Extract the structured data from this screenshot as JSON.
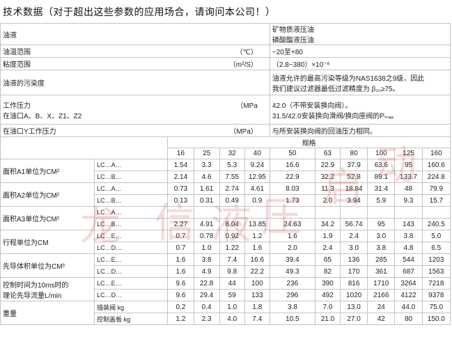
{
  "title": "技术数据（对于超出这些参数的应用场合，请询问本公司！）",
  "watermark": "龙 信 液 压 启 动",
  "info_rows": [
    {
      "label": "油液",
      "unit": "",
      "value": "矿物质液压油",
      "value2": "磷酸酯液压油"
    },
    {
      "label": "油温范围",
      "unit": "（℃）",
      "value": "−20至+80"
    },
    {
      "label": "粘度范围",
      "unit": "（m²/S）",
      "value": "（2.8−380）×10⁻⁶"
    },
    {
      "label": "油液的污染度",
      "unit": "",
      "value": "油液允许的最高污染等级为NAS1638之9级，因此",
      "value2": "我们建议过滤器最低过滤精度为 β₁₀≥75。"
    },
    {
      "label": "工作压力",
      "label2": "在油口A、B、X、Z1、Z2",
      "unit": "（MPa",
      "value": "42.0（不带安装换向阀）。",
      "value2": "31.5/42.0安装换向滑阀/换向座阀的Pₘₐₓ"
    },
    {
      "label": "在油口Y工作压力",
      "unit": "（MPa）",
      "value": "与所安装换向阀的回油压力相同。"
    }
  ],
  "spec_header": "规格",
  "sizes": [
    "16",
    "25",
    "32",
    "40",
    "50",
    "63",
    "80",
    "100",
    "125",
    "160"
  ],
  "spec_groups": [
    {
      "label": "面积A1单位为CM²",
      "rows": [
        {
          "sub": "LC…A…",
          "vals": [
            "1.54",
            "3.3",
            "5.3",
            "9.24",
            "16.6",
            "22.9",
            "37.9",
            "63.6",
            "95",
            "160.6"
          ]
        },
        {
          "sub": "LC…B…",
          "vals": [
            "2.14",
            "4.6",
            "7.55",
            "12.95",
            "22.9",
            "32.2",
            "52.8",
            "89.1",
            "133.7",
            "224.8"
          ]
        }
      ]
    },
    {
      "label": "面积A2单位为CM²",
      "rows": [
        {
          "sub": "LC…A…",
          "vals": [
            "0.73",
            "1.61",
            "2.74",
            "4.61",
            "8.03",
            "11.3",
            "18.84",
            "31.4",
            "48",
            "79.9"
          ]
        },
        {
          "sub": "LC…B…",
          "vals": [
            "0.13",
            "0.31",
            "0.49",
            "0.9",
            "1.73",
            "2.0",
            "3.94",
            "5.9",
            "9.3",
            "15.7"
          ]
        }
      ]
    },
    {
      "label": "面积A3单位为CM²",
      "rows": [
        {
          "sub": "LC…A…",
          "vals": [
            "",
            "",
            "",
            "",
            "",
            "",
            "",
            "",
            "",
            ""
          ]
        },
        {
          "sub": "LC…B…",
          "vals": [
            "2.27",
            "4.91",
            "8.04",
            "13.85",
            "24.63",
            "34.2",
            "56.74",
            "95",
            "143",
            "240.5"
          ]
        }
      ]
    },
    {
      "label": "行程单位为CM",
      "rows": [
        {
          "sub": "LC…E…",
          "vals": [
            "0.7",
            "0.78",
            "0.92",
            "1.2",
            "1.6",
            "1.9",
            "2.4",
            "3.0",
            "3.8",
            "5.0"
          ]
        },
        {
          "sub": "LC…D…",
          "vals": [
            "0.7",
            "1.0",
            "1.22",
            "1.6",
            "2.0",
            "2.4",
            "3.0",
            "3.8",
            "4.8",
            "6.5"
          ]
        }
      ]
    },
    {
      "label": "先导体积单位为CM³",
      "rows": [
        {
          "sub": "LC…E…",
          "vals": [
            "1.6",
            "3.8",
            "7.4",
            "16.6",
            "39.4",
            "65",
            "136",
            "285",
            "544",
            "1203"
          ]
        },
        {
          "sub": "LC…D…",
          "vals": [
            "1.6",
            "4.9",
            "9.8",
            "22.2",
            "49.3",
            "82",
            "170",
            "361",
            "687",
            "1563"
          ]
        }
      ]
    },
    {
      "label": "控制时间为10ms时的",
      "label2": "理论先导流量L/min",
      "rows": [
        {
          "sub": "LC…E…",
          "vals": [
            "9.6",
            "22.8",
            "44",
            "100",
            "236",
            "390",
            "816",
            "1710",
            "3264",
            "7218"
          ]
        },
        {
          "sub": "LC…D…",
          "vals": [
            "9.6",
            "29.4",
            "59",
            "133",
            "296",
            "492",
            "1020",
            "2166",
            "4122",
            "9378"
          ]
        }
      ]
    },
    {
      "label": "重量",
      "rows": [
        {
          "sub": "插装阀 kg",
          "vals": [
            "0.2",
            "0.4",
            "1.0",
            "1.8",
            "3.8",
            "7.0",
            "13.0",
            "24",
            "44.0",
            "75.0"
          ]
        },
        {
          "sub": "控制盖板 kg",
          "vals": [
            "1.2",
            "2.3",
            "4.0",
            "7.4",
            "10.5",
            "21.0",
            "27.0",
            "42",
            "80",
            "150.0"
          ]
        }
      ]
    }
  ]
}
